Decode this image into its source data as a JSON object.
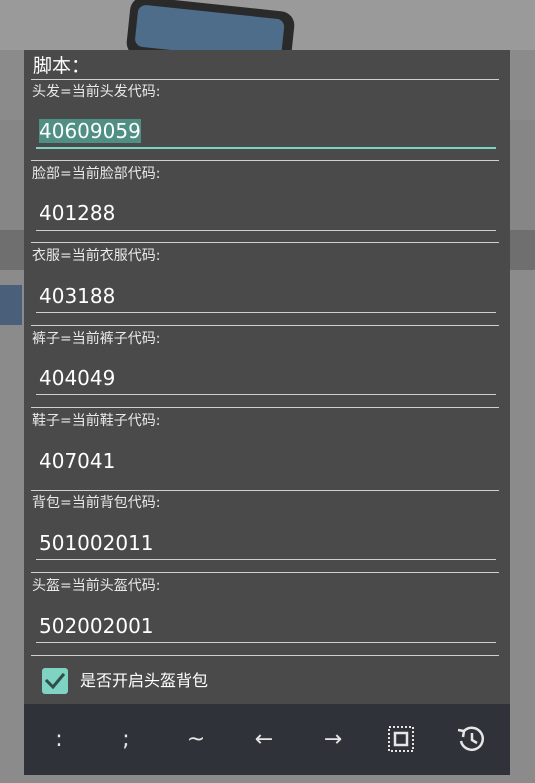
{
  "dialog": {
    "title": "脚本："
  },
  "fields": [
    {
      "label": "头发=当前头发代码:",
      "value": "40609059",
      "focused": true
    },
    {
      "label": "脸部=当前脸部代码:",
      "value": "401288"
    },
    {
      "label": "衣服=当前衣服代码:",
      "value": "403188"
    },
    {
      "label": "裤子=当前裤子代码:",
      "value": "404049"
    },
    {
      "label": "鞋子=当前鞋子代码:",
      "value": "407041"
    },
    {
      "label": "背包=当前背包代码:",
      "value": "501002011"
    },
    {
      "label": "头盔=当前头盔代码:",
      "value": "502002001"
    }
  ],
  "checkbox": {
    "label": "是否开启头盔背包",
    "checked": true
  },
  "keybar": {
    "keys": [
      ":",
      ";",
      "~",
      "←",
      "→"
    ],
    "select_icon": "select-all-icon",
    "history_icon": "history-icon"
  },
  "colors": {
    "accent": "#7fd3c3",
    "dialog_bg": "#4a4a4a",
    "keybar_bg": "#2f3339"
  }
}
